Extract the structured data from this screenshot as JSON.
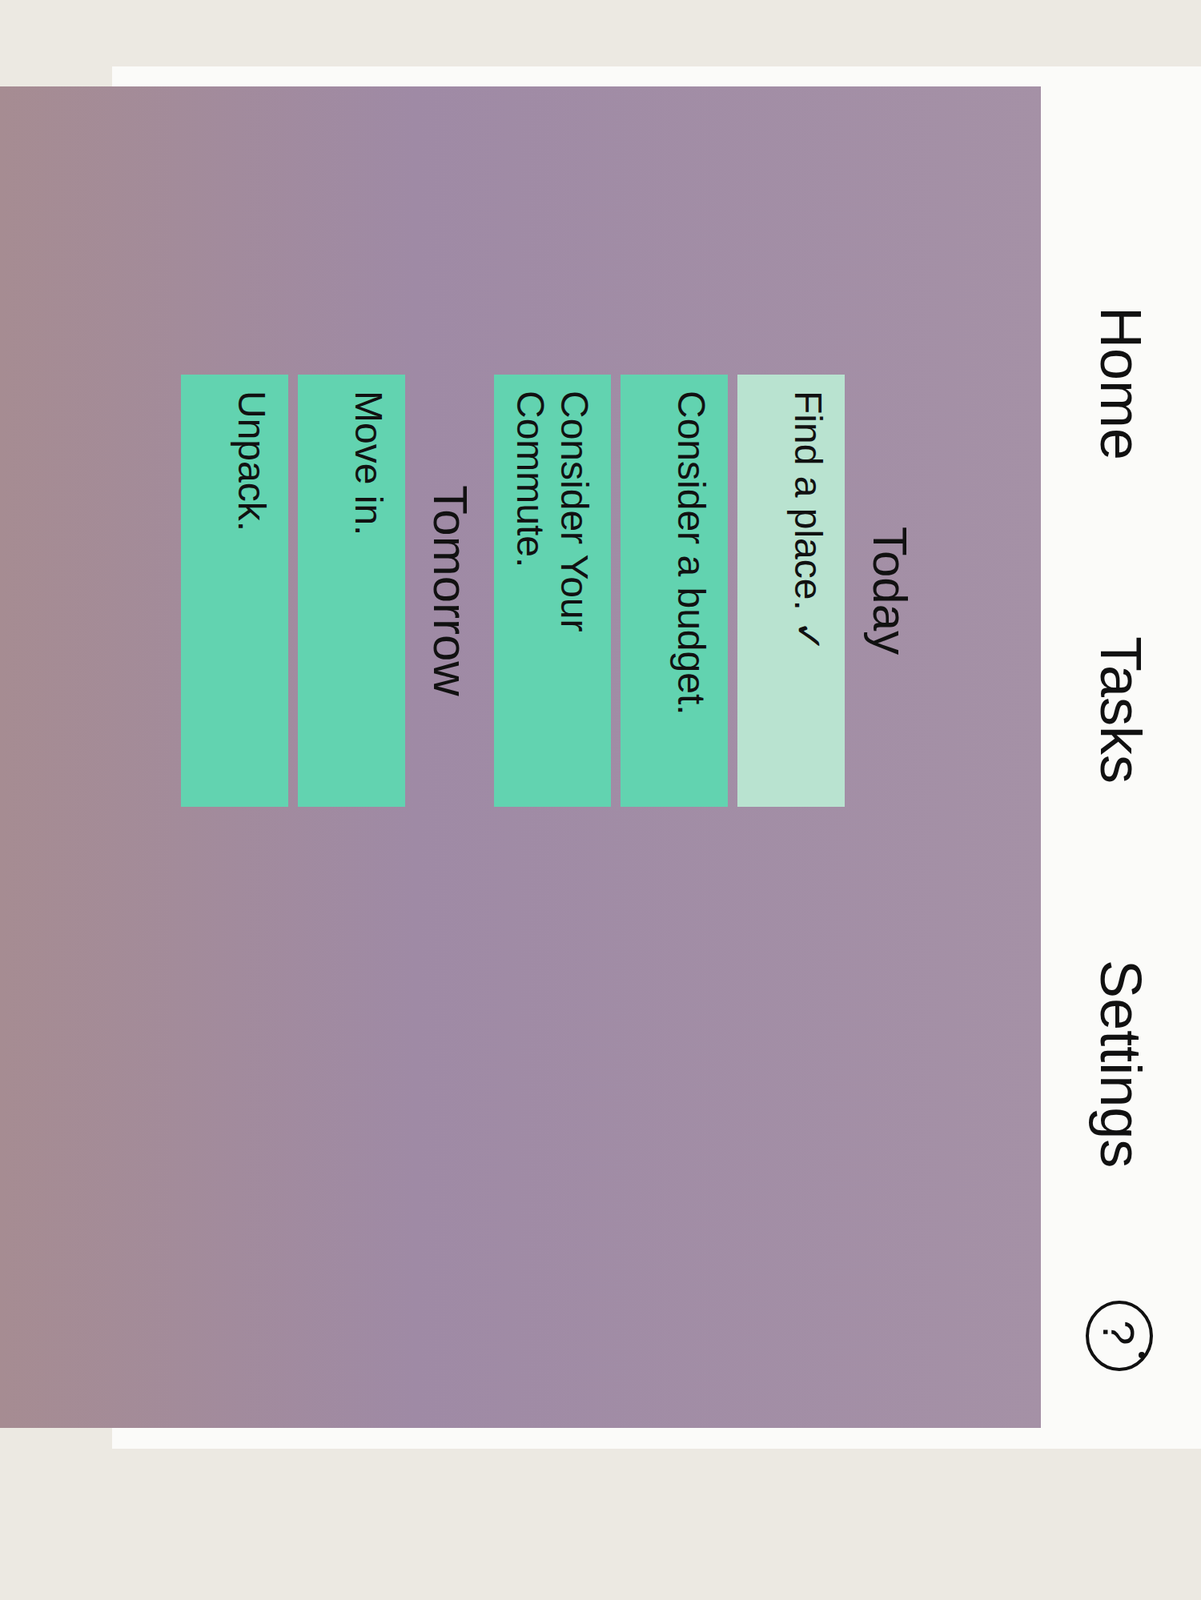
{
  "nav": {
    "items": [
      {
        "label": "Home"
      },
      {
        "label": "Tasks"
      },
      {
        "label": "Settings"
      }
    ],
    "help_icon": "?"
  },
  "sections": [
    {
      "title": "Today",
      "tasks": [
        {
          "label": "Find a place.",
          "done": true
        },
        {
          "label": "Consider a budget.",
          "done": false
        },
        {
          "label": "Consider Your Commute.",
          "done": false
        }
      ]
    },
    {
      "title": "Tomorrow",
      "tasks": [
        {
          "label": "Move in.",
          "done": false
        },
        {
          "label": "Unpack.",
          "done": false
        }
      ]
    }
  ],
  "done_mark": "✓"
}
